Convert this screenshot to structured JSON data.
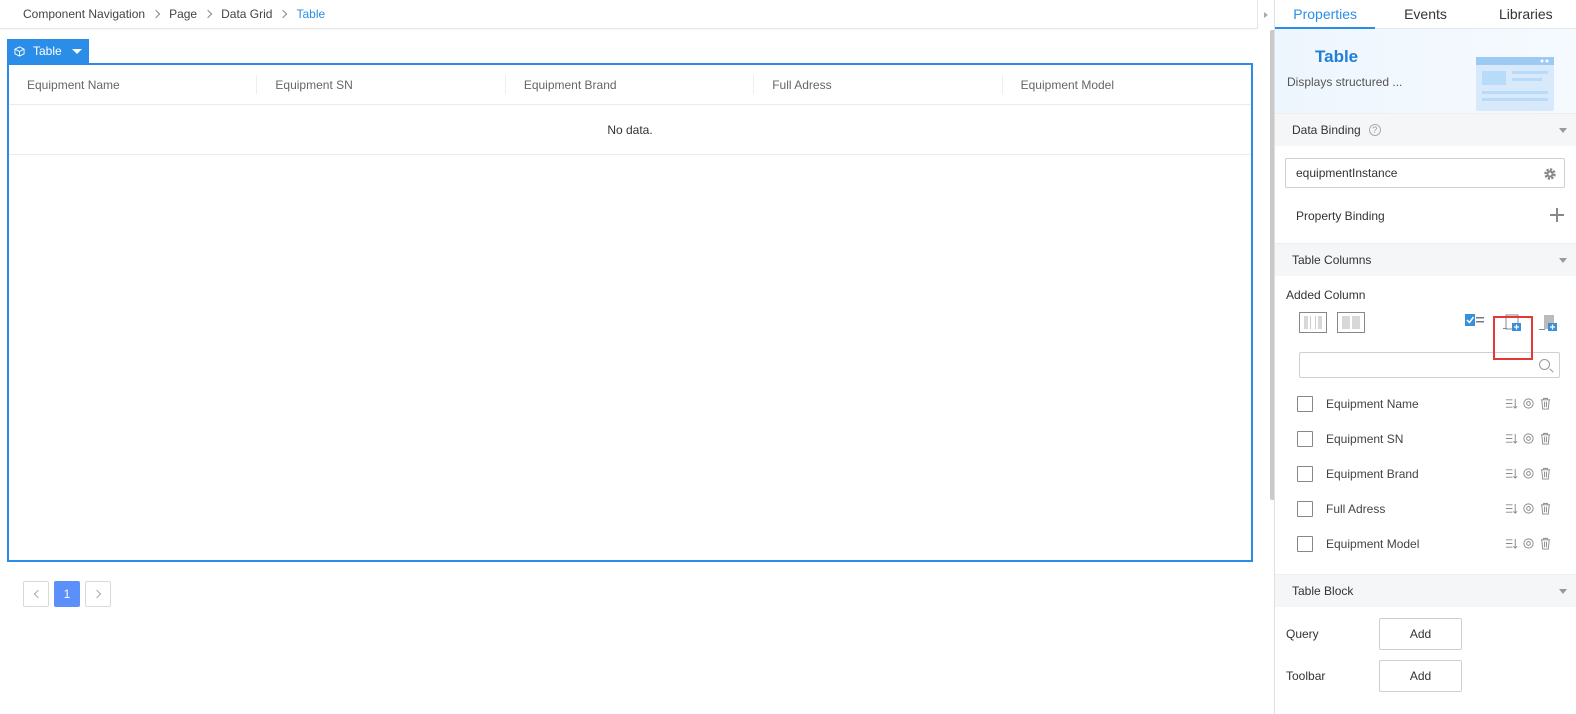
{
  "breadcrumb": [
    "Component Navigation",
    "Page",
    "Data Grid",
    "Table"
  ],
  "component_tag": {
    "label": "Table"
  },
  "table": {
    "columns": [
      "Equipment Name",
      "Equipment SN",
      "Equipment Brand",
      "Full Adress",
      "Equipment Model"
    ],
    "empty_text": "No data."
  },
  "pager": {
    "current_page": "1"
  },
  "panel": {
    "tabs": [
      "Properties",
      "Events",
      "Libraries"
    ],
    "active_tab": "Properties",
    "hero": {
      "title": "Table",
      "description": "Displays structured ..."
    },
    "data_binding": {
      "title": "Data Binding",
      "value": "equipmentInstance",
      "property_binding_label": "Property Binding"
    },
    "table_columns": {
      "title": "Table Columns",
      "added_column_label": "Added Column",
      "search_placeholder": "",
      "items": [
        "Equipment Name",
        "Equipment SN",
        "Equipment Brand",
        "Full Adress",
        "Equipment Model"
      ]
    },
    "table_block": {
      "title": "Table Block",
      "rows": [
        {
          "label": "Query",
          "button": "Add"
        },
        {
          "label": "Toolbar",
          "button": "Add"
        }
      ]
    }
  },
  "colors": {
    "accent": "#2a8ee8",
    "page_active": "#5b8ff9",
    "highlight": "#e53935"
  }
}
